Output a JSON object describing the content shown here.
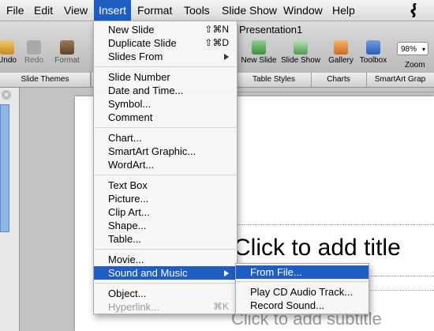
{
  "menubar": {
    "items": [
      {
        "label": "File"
      },
      {
        "label": "Edit"
      },
      {
        "label": "View"
      },
      {
        "label": "Insert"
      },
      {
        "label": "Format"
      },
      {
        "label": "Tools"
      },
      {
        "label": "Slide Show"
      },
      {
        "label": "Window"
      },
      {
        "label": "Help"
      }
    ],
    "active_item": "Insert",
    "script_icon": "script-menu-icon"
  },
  "toolbar": {
    "document_title": "Presentation1",
    "left_buttons": [
      {
        "label": "Undo",
        "icon": "undo-icon"
      },
      {
        "label": "Redo",
        "icon": "redo-icon"
      },
      {
        "label": "Format",
        "icon": "format-brush-icon"
      }
    ],
    "right_buttons": [
      {
        "label": "New Slide",
        "icon": "new-slide-icon"
      },
      {
        "label": "Slide Show",
        "icon": "slide-show-icon"
      },
      {
        "label": "Gallery",
        "icon": "gallery-icon"
      },
      {
        "label": "Toolbox",
        "icon": "toolbox-icon"
      }
    ],
    "zoom": {
      "value": "98%",
      "label": "Zoom"
    }
  },
  "ribbon": {
    "tabs": [
      "Slide Themes",
      "Table Styles",
      "Charts",
      "SmartArt Grap"
    ]
  },
  "insert_menu": {
    "groups": [
      [
        {
          "label": "New Slide",
          "shortcut": "⇧⌘N"
        },
        {
          "label": "Duplicate Slide",
          "shortcut": "⇧⌘D"
        },
        {
          "label": "Slides From",
          "submenu": true
        }
      ],
      [
        {
          "label": "Slide Number"
        },
        {
          "label": "Date and Time..."
        },
        {
          "label": "Symbol..."
        },
        {
          "label": "Comment"
        }
      ],
      [
        {
          "label": "Chart..."
        },
        {
          "label": "SmartArt Graphic..."
        },
        {
          "label": "WordArt..."
        }
      ],
      [
        {
          "label": "Text Box"
        },
        {
          "label": "Picture..."
        },
        {
          "label": "Clip Art..."
        },
        {
          "label": "Shape..."
        },
        {
          "label": "Table..."
        }
      ],
      [
        {
          "label": "Movie..."
        },
        {
          "label": "Sound and Music",
          "submenu": true,
          "highlighted": true
        }
      ],
      [
        {
          "label": "Object..."
        },
        {
          "label": "Hyperlink...",
          "shortcut": "⌘K",
          "disabled": true
        }
      ]
    ]
  },
  "sound_submenu": {
    "groups": [
      [
        {
          "label": "From File...",
          "highlighted": true
        }
      ],
      [
        {
          "label": "Play CD Audio Track..."
        },
        {
          "label": "Record Sound..."
        }
      ]
    ]
  },
  "slide": {
    "title_placeholder": "Click to add title",
    "subtitle_placeholder": "Click to add subtitle"
  },
  "colors": {
    "menu_highlight": "#1e5ec2",
    "menubar_bg": "#e8e8e8"
  }
}
